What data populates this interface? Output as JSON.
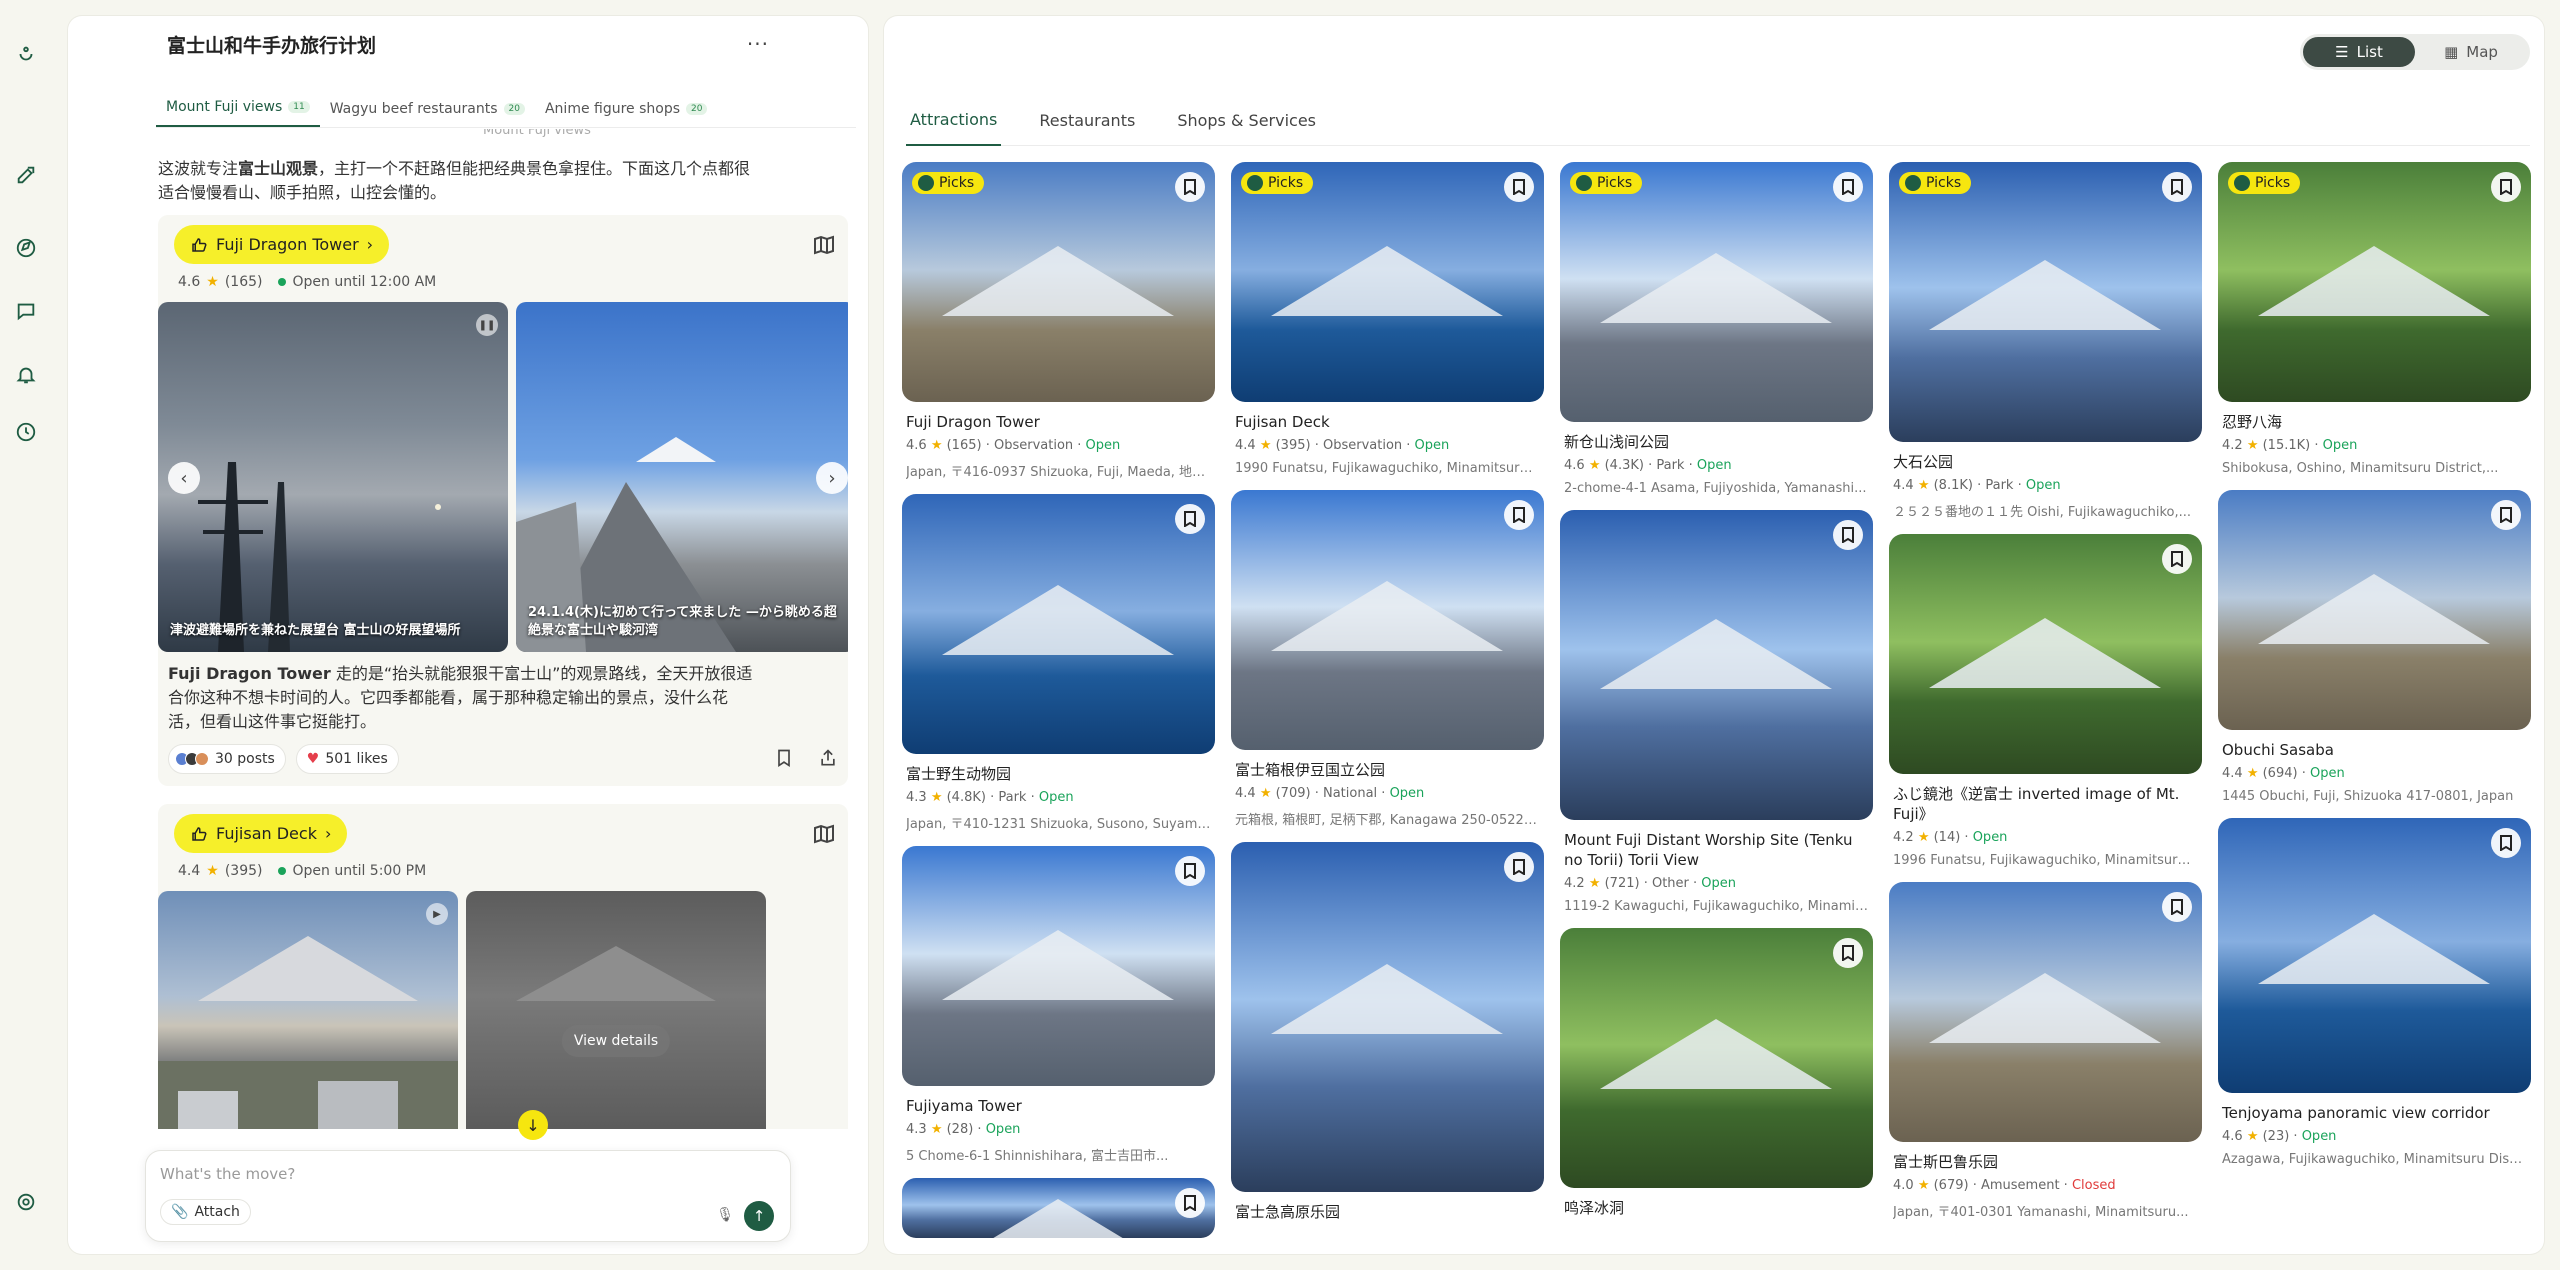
{
  "chat": {
    "title": "富士山和牛手办旅行计划",
    "more": "···",
    "tabs": [
      {
        "label": "Mount Fuji views",
        "count": "11"
      },
      {
        "label": "Wagyu beef restaurants",
        "count": "20"
      },
      {
        "label": "Anime figure shops",
        "count": "20"
      }
    ],
    "faded_text": "Mount Fuji views",
    "intro_pre": "这波就专注",
    "intro_bold": "富士山观景",
    "intro_post": "，主打一个不赶路但能把经典景色拿捏住。下面这几个点都很适合慢慢看山、顺手拍照，山控会懂的。",
    "places": [
      {
        "name": "Fuji Dragon Tower",
        "rating": "4.6",
        "reviews": "(165)",
        "status": "Open until 12:00 AM",
        "captions": [
          "津波避難場所を兼ねた展望台 富士山の好展望場所",
          "24.1.4(木)に初めて行って来ました —から眺める超絶景な富士山や駿河湾"
        ],
        "desc_bold": "Fuji Dragon Tower",
        "desc_rest": " 走的是“抬头就能狠狠干富士山”的观景路线，全天开放很适合你这种不想卡时间的人。它四季都能看，属于那种稳定输出的景点，没什么花活，但看山这件事它挺能打。",
        "posts": "30 posts",
        "likes": "501 likes"
      },
      {
        "name": "Fujisan Deck",
        "rating": "4.4",
        "reviews": "(395)",
        "status": "Open until 5:00 PM",
        "view_details": "View details"
      }
    ],
    "composer_placeholder": "What's the move?",
    "attach_label": "Attach"
  },
  "right": {
    "toggle": {
      "list": "List",
      "map": "Map"
    },
    "tabs": [
      "Attractions",
      "Restaurants",
      "Shops & Services"
    ],
    "picks_label": "Picks",
    "columns": [
      [
        {
          "name": "Fuji Dragon Tower",
          "rating": "4.6",
          "reviews": "(165)",
          "category": "Observation",
          "status": "Open",
          "address": "Japan, 〒416-0937 Shizuoka, Fuji, Maeda, 地先 ...",
          "picks": true
        },
        {
          "name": "富士野生动物园",
          "rating": "4.3",
          "reviews": "(4.8K)",
          "category": "Park",
          "status": "Open",
          "address": "Japan, 〒410-1231 Shizuoka, Susono, Suyama, 字...",
          "picks": false
        },
        {
          "name": "Fujiyama Tower",
          "rating": "4.3",
          "reviews": "(28)",
          "category": "",
          "status": "Open",
          "address": "5 Chome-6-1 Shinnishihara, 富士吉田市...",
          "picks": false
        },
        {
          "name": "",
          "rating": "",
          "reviews": "",
          "category": "",
          "status": "",
          "address": "",
          "picks": false
        }
      ],
      [
        {
          "name": "Fujisan Deck",
          "rating": "4.4",
          "reviews": "(395)",
          "category": "Observation",
          "status": "Open",
          "address": "1990 Funatsu, Fujikawaguchiko, Minamitsuru...",
          "picks": true
        },
        {
          "name": "富士箱根伊豆国立公园",
          "rating": "4.4",
          "reviews": "(709)",
          "category": "National",
          "status": "Open",
          "address": "元箱根, 箱根町, 足柄下郡, Kanagawa 250-0522,...",
          "picks": false
        },
        {
          "name": "富士急高原乐园",
          "rating": "",
          "reviews": "",
          "category": "",
          "status": "",
          "address": "",
          "picks": false
        }
      ],
      [
        {
          "name": "新仓山浅间公园",
          "rating": "4.6",
          "reviews": "(4.3K)",
          "category": "Park",
          "status": "Open",
          "address": "2-chome-4-1 Asama, Fujiyoshida, Yamanashi...",
          "picks": true
        },
        {
          "name": "Mount Fuji Distant Worship Site (Tenku no Torii) Torii View",
          "rating": "4.2",
          "reviews": "(721)",
          "category": "Other",
          "status": "Open",
          "address": "1119-2 Kawaguchi, Fujikawaguchiko, Minamitsur...",
          "picks": false
        },
        {
          "name": "鸣泽冰洞",
          "rating": "",
          "reviews": "",
          "category": "",
          "status": "",
          "address": "",
          "picks": false
        }
      ],
      [
        {
          "name": "大石公园",
          "rating": "4.4",
          "reviews": "(8.1K)",
          "category": "Park",
          "status": "Open",
          "address": "２５２５番地の１１先 Oishi, Fujikawaguchiko,...",
          "picks": true
        },
        {
          "name": "ふじ鏡池《逆富士 inverted image of Mt. Fuji》",
          "rating": "4.2",
          "reviews": "(14)",
          "category": "",
          "status": "Open",
          "address": "1996 Funatsu, Fujikawaguchiko, Minamitsuru...",
          "picks": false
        },
        {
          "name": "富士斯巴鲁乐园",
          "rating": "4.0",
          "reviews": "(679)",
          "category": "Amusement",
          "status": "Closed",
          "address": "Japan, 〒401-0301 Yamanashi, Minamitsuru...",
          "picks": false
        }
      ],
      [
        {
          "name": "忍野八海",
          "rating": "4.2",
          "reviews": "(15.1K)",
          "category": "",
          "status": "Open",
          "address": "Shibokusa, Oshino, Minamitsuru District,...",
          "picks": true
        },
        {
          "name": "Obuchi Sasaba",
          "rating": "4.4",
          "reviews": "(694)",
          "category": "",
          "status": "Open",
          "address": "1445 Obuchi, Fuji, Shizuoka 417-0801, Japan",
          "picks": false
        },
        {
          "name": "Tenjoyama panoramic view corridor",
          "rating": "4.6",
          "reviews": "(23)",
          "category": "",
          "status": "Open",
          "address": "Azagawa, Fujikawaguchiko, Minamitsuru Distr...",
          "picks": false
        }
      ]
    ]
  }
}
